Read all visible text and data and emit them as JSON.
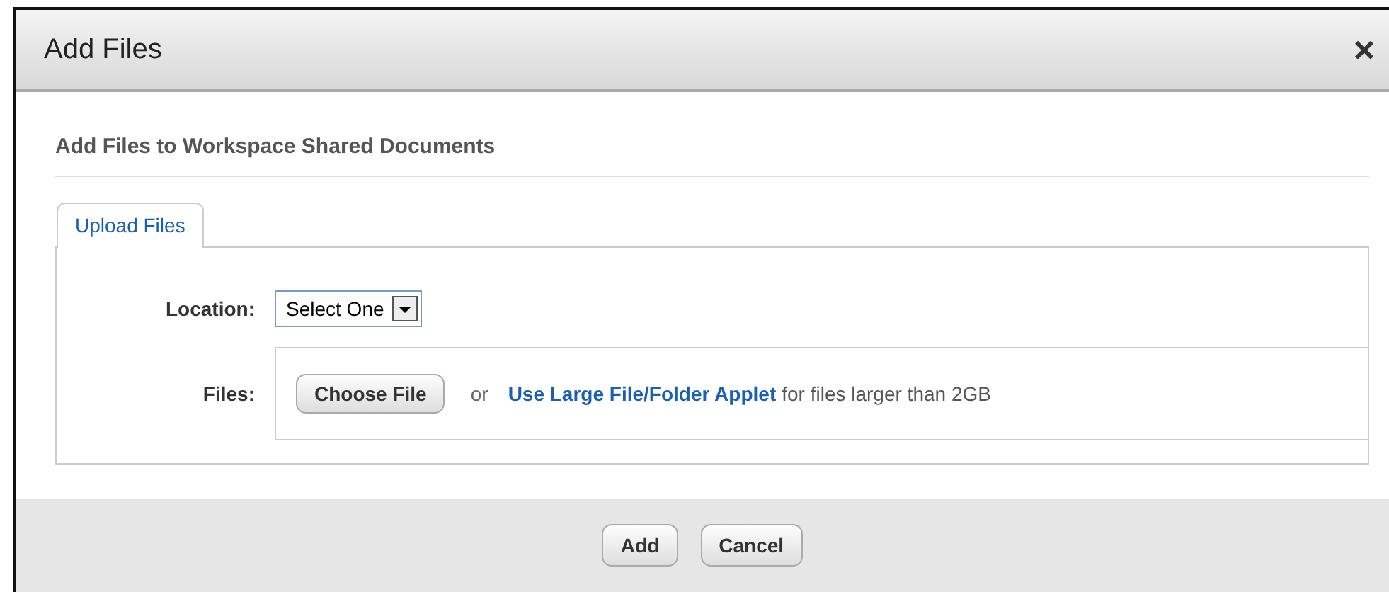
{
  "window": {
    "title": "Add Files",
    "close": "×"
  },
  "heading": "Add Files to Workspace Shared Documents",
  "tabs": [
    {
      "label": "Upload Files",
      "selected": true
    }
  ],
  "form": {
    "location": {
      "label": "Location:",
      "value": "Select One"
    },
    "files": {
      "label": "Files:",
      "button": "Choose File",
      "or": "or",
      "link": "Use Large File/Folder Applet",
      "note": "for files larger than 2GB"
    }
  },
  "buttons": [
    "Add",
    "Cancel"
  ]
}
